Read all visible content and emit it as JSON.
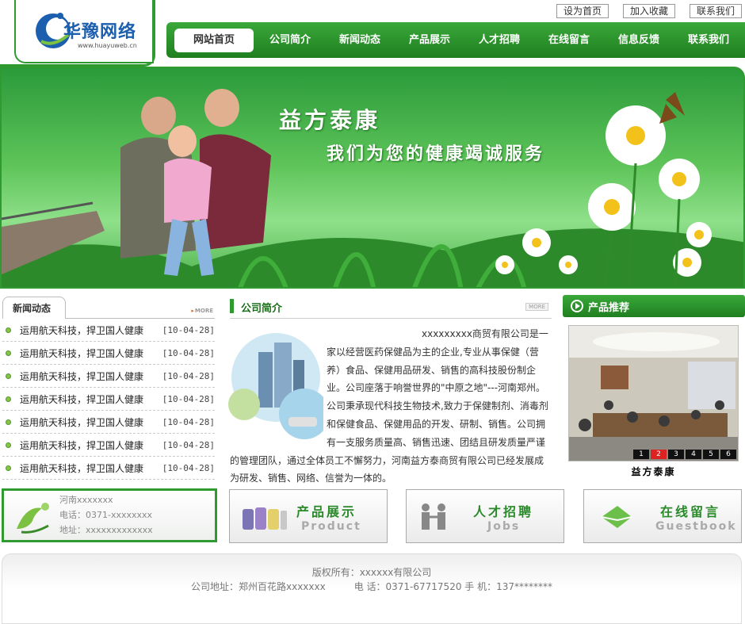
{
  "logo": {
    "text": "华豫网络",
    "url": "www.huayuweb.cn"
  },
  "top_links": [
    "设为首页",
    "加入收藏",
    "联系我们"
  ],
  "nav": {
    "items": [
      "网站首页",
      "公司简介",
      "新闻动态",
      "产品展示",
      "人才招聘",
      "在线留言",
      "信息反馈",
      "联系我们"
    ]
  },
  "banner": {
    "title": "益方泰康",
    "subtitle": "我们为您的健康竭诚服务"
  },
  "news": {
    "title": "新闻动态",
    "more": "MORE",
    "items": [
      {
        "title": "运用航天科技，捍卫国人健康",
        "date": "[10-04-28]"
      },
      {
        "title": "运用航天科技，捍卫国人健康",
        "date": "[10-04-28]"
      },
      {
        "title": "运用航天科技，捍卫国人健康",
        "date": "[10-04-28]"
      },
      {
        "title": "运用航天科技，捍卫国人健康",
        "date": "[10-04-28]"
      },
      {
        "title": "运用航天科技，捍卫国人健康",
        "date": "[10-04-28]"
      },
      {
        "title": "运用航天科技，捍卫国人健康",
        "date": "[10-04-28]"
      },
      {
        "title": "运用航天科技，捍卫国人健康",
        "date": "[10-04-28]"
      }
    ]
  },
  "contact": {
    "region": "河南xxxxxxx",
    "phone": "电话：0371-xxxxxxxx",
    "address": "地址：xxxxxxxxxxxxx"
  },
  "about": {
    "title": "公司简介",
    "more": "MORE",
    "text": "xxxxxxxxx商贸有限公司是一家以经营医药保健品为主的企业,专业从事保健（营养）食品、保健用品研发、销售的高科技股份制企业。公司座落于响誉世界的\"中原之地\"---河南郑州。公司秉承现代科技生物技术,致力于保健制剂、消毒剂和保健食品、保健用品的开发、研制、销售。公司拥有一支服务质量高、销售迅速、团结且研发质量严谨的管理团队，通过全体员工不懈努力，河南益方泰商贸有限公司已经发展成为研发、销售、网络、信誉为一体的。"
  },
  "recommend": {
    "title": "产品推荐",
    "caption": "益方泰康",
    "pages": [
      "1",
      "2",
      "3",
      "4",
      "5",
      "6"
    ],
    "active_page": "2"
  },
  "features": [
    {
      "cn": "产品展示",
      "en": "Product"
    },
    {
      "cn": "人才招聘",
      "en": "Jobs"
    },
    {
      "cn": "在线留言",
      "en": "Guestbook"
    }
  ],
  "footer": {
    "copyright": "版权所有：xxxxxx有限公司",
    "address": "公司地址：郑州百花路xxxxxxx",
    "phone": "电 话：0371-67717520 手 机：137********"
  },
  "colors": {
    "brand_green": "#2f9a2f",
    "nav_green": "#1f7f1f",
    "logo_blue": "#1b5fae"
  }
}
